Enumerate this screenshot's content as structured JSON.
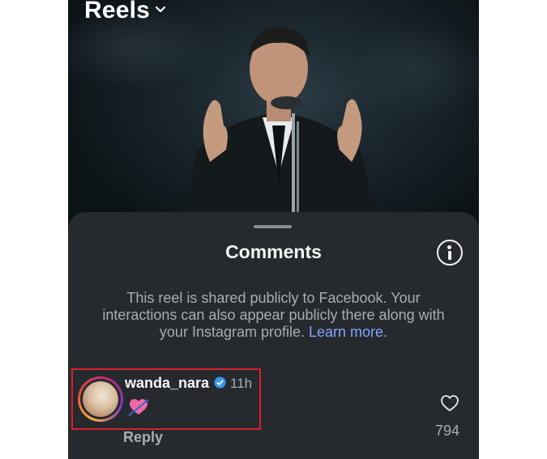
{
  "header": {
    "title": "Reels",
    "dropdown_icon": "chevron-down-icon"
  },
  "sheet": {
    "title": "Comments",
    "info_icon": "info-icon",
    "notice_text": "This reel is shared publicly to Facebook. Your interactions can also appear publicly there along with your Instagram profile.",
    "notice_link": "Learn more."
  },
  "comments": [
    {
      "username": "wanda_nara",
      "verified": true,
      "time": "11h",
      "content_icon": "heart-with-arrow-emoji",
      "reply_label": "Reply",
      "likes": "794"
    }
  ],
  "colors": {
    "highlight_box": "#d6202a",
    "link": "#7fa7ff",
    "sheet_bg": "#262a2e"
  }
}
